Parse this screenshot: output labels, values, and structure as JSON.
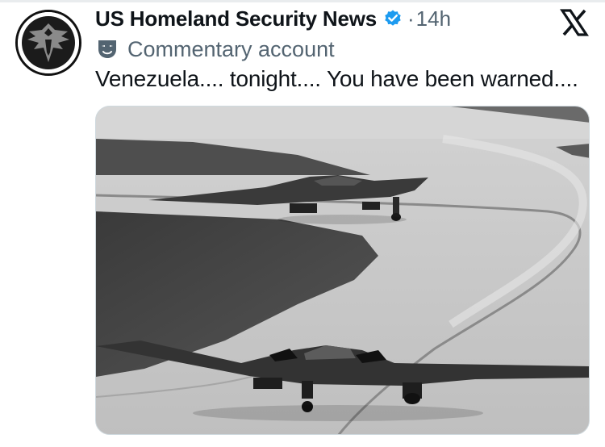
{
  "tweet": {
    "author_name": "US Homeland Security News",
    "time_separator": "·",
    "time": "14h",
    "account_label": "Commentary account",
    "text": "Venezuela.... tonight.... You have been warned....",
    "icons": {
      "avatar": "eagle-shield-logo",
      "verified": "verified-badge-icon",
      "label": "theater-mask-icon",
      "platform": "x-logo-icon"
    },
    "colors": {
      "verified": "#1d9bf0",
      "secondary_text": "#536471"
    },
    "media": {
      "kind": "photo",
      "subject": "two stealth bombers on taxiway"
    }
  }
}
